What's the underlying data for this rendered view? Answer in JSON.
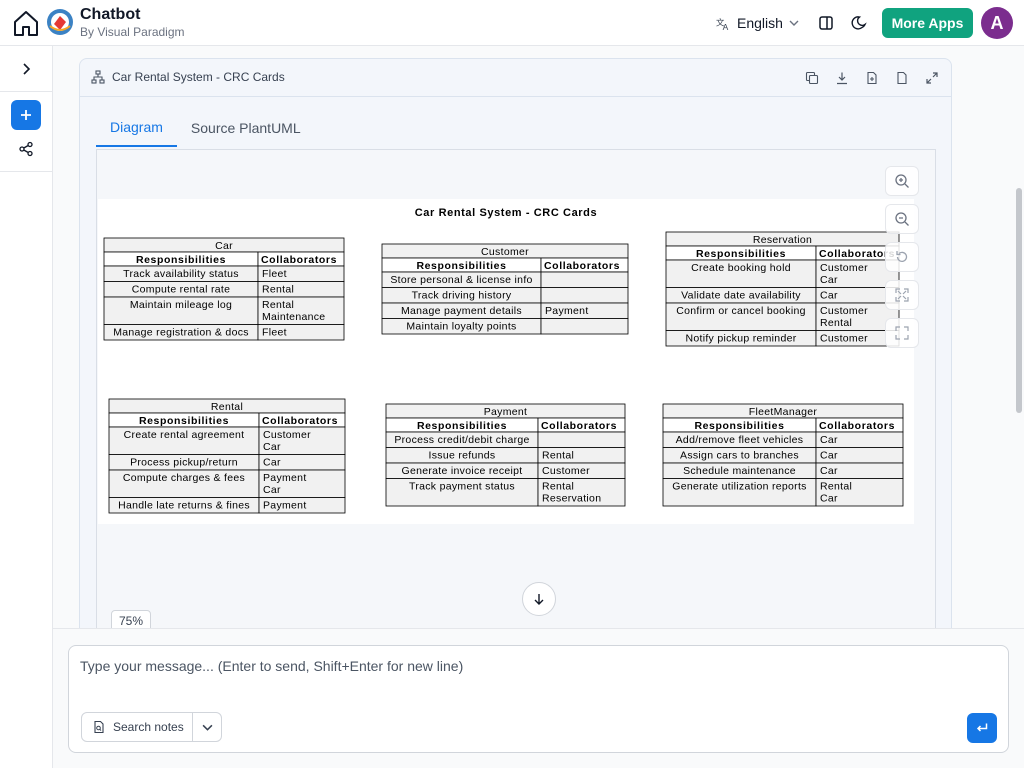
{
  "header": {
    "title": "Chatbot",
    "subtitle": "By Visual Paradigm",
    "language": "English",
    "more_apps": "More Apps",
    "avatar_initial": "A",
    "accent": "#10a37f",
    "avatar_color": "#7b2d8e"
  },
  "card": {
    "title": "Car Rental System - CRC Cards",
    "tabs": [
      "Diagram",
      "Source PlantUML"
    ],
    "active_tab": "Diagram",
    "zoom": "75%"
  },
  "diagram": {
    "title": "Car Rental System - CRC Cards",
    "resp_header": "Responsibilities",
    "collab_header": "Collaborators",
    "cards": [
      {
        "name": "Car",
        "rows": [
          [
            "Track availability status",
            "Fleet"
          ],
          [
            "Compute rental rate",
            "Rental"
          ],
          [
            "Maintain mileage log",
            "Rental\nMaintenance"
          ],
          [
            "Manage registration & docs",
            "Fleet"
          ]
        ]
      },
      {
        "name": "Customer",
        "rows": [
          [
            "Store personal & license info",
            ""
          ],
          [
            "Track driving history",
            ""
          ],
          [
            "Manage payment details",
            "Payment"
          ],
          [
            "Maintain loyalty points",
            ""
          ]
        ]
      },
      {
        "name": "Reservation",
        "rows": [
          [
            "Create booking hold",
            "Customer\nCar"
          ],
          [
            "Validate date availability",
            "Car"
          ],
          [
            "Confirm or cancel booking",
            "Customer\nRental"
          ],
          [
            "Notify pickup reminder",
            "Customer"
          ]
        ]
      },
      {
        "name": "Rental",
        "rows": [
          [
            "Create rental agreement",
            "Customer\nCar"
          ],
          [
            "Process pickup/return",
            "Car"
          ],
          [
            "Compute charges & fees",
            "Payment\nCar"
          ],
          [
            "Handle late returns & fines",
            "Payment"
          ]
        ]
      },
      {
        "name": "Payment",
        "rows": [
          [
            "Process credit/debit charge",
            ""
          ],
          [
            "Issue refunds",
            "Rental"
          ],
          [
            "Generate invoice receipt",
            "Customer"
          ],
          [
            "Track payment status",
            "Rental\nReservation"
          ]
        ]
      },
      {
        "name": "FleetManager",
        "rows": [
          [
            "Add/remove fleet vehicles",
            "Car"
          ],
          [
            "Assign cars to branches",
            "Car"
          ],
          [
            "Schedule maintenance",
            "Car"
          ],
          [
            "Generate utilization reports",
            "Rental\nCar"
          ]
        ]
      }
    ]
  },
  "composer": {
    "placeholder": "Type your message... (Enter to send, Shift+Enter for new line)",
    "notes_label": "Search notes"
  }
}
